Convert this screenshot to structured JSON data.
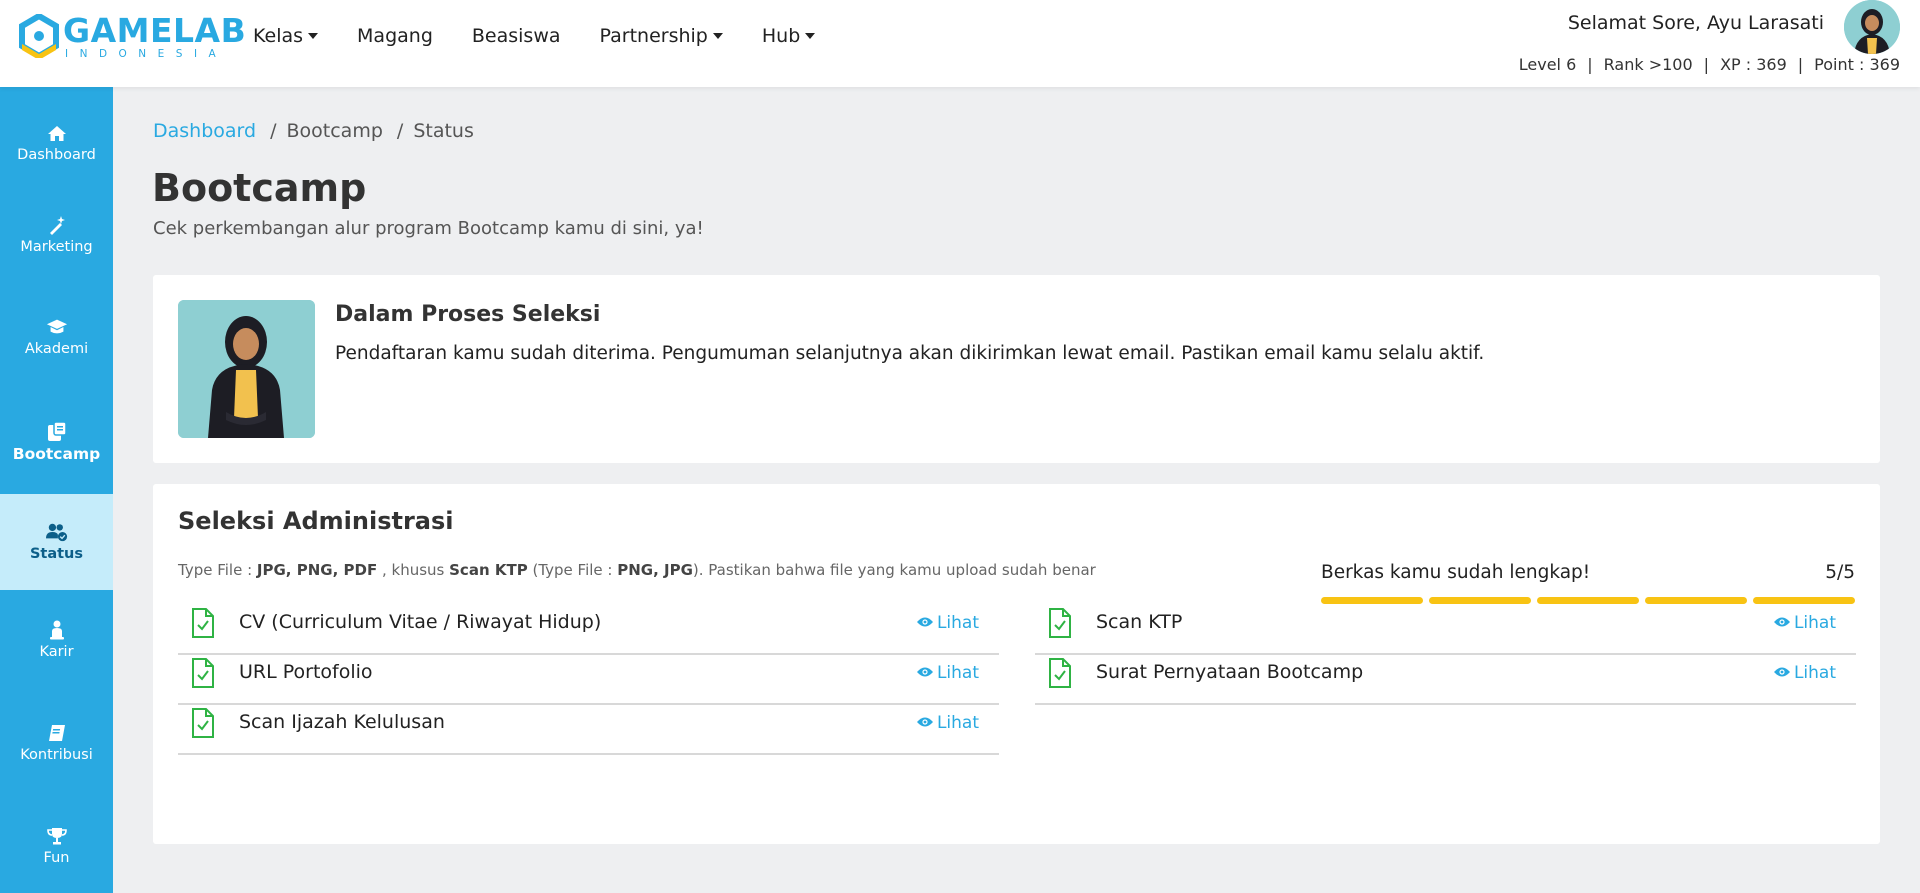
{
  "brand": {
    "name": "GAMELAB",
    "sub": "INDONESIA",
    "color": "#29a9e1"
  },
  "nav": [
    {
      "label": "Kelas",
      "dropdown": true
    },
    {
      "label": "Magang",
      "dropdown": false
    },
    {
      "label": "Beasiswa",
      "dropdown": false
    },
    {
      "label": "Partnership",
      "dropdown": true
    },
    {
      "label": "Hub",
      "dropdown": true
    }
  ],
  "user": {
    "greeting": "Selamat Sore, Ayu Larasati",
    "level": "Level 6",
    "rank": "Rank >100",
    "xp": "XP : 369",
    "point": "Point : 369"
  },
  "sidebar": [
    {
      "label": "Dashboard",
      "icon": "home-icon"
    },
    {
      "label": "Marketing",
      "icon": "magic-wand-icon"
    },
    {
      "label": "Akademi",
      "icon": "graduation-cap-icon"
    },
    {
      "label": "Bootcamp",
      "icon": "briefcase-doc-icon"
    },
    {
      "label": "Status",
      "icon": "users-check-icon",
      "active": true
    },
    {
      "label": "Karir",
      "icon": "person-icon"
    },
    {
      "label": "Kontribusi",
      "icon": "book-icon"
    },
    {
      "label": "Fun",
      "icon": "trophy-icon"
    }
  ],
  "breadcrumb": {
    "home": "Dashboard",
    "mid": "Bootcamp",
    "current": "Status"
  },
  "page": {
    "title": "Bootcamp",
    "subtitle": "Cek perkembangan alur program Bootcamp kamu di sini, ya!"
  },
  "status_card": {
    "title": "Dalam Proses Seleksi",
    "description": "Pendaftaran kamu sudah diterima. Pengumuman selanjutnya akan dikirimkan lewat email. Pastikan email kamu selalu aktif."
  },
  "admin": {
    "title": "Seleksi Administrasi",
    "filetype": {
      "prefix": "Type File : ",
      "types": "JPG, PNG, PDF",
      "mid": " , khusus ",
      "ktp": "Scan KTP",
      "mid2": " (Type File : ",
      "ktp_types": "PNG, JPG",
      "suffix": "). Pastikan bahwa file yang kamu upload sudah benar"
    },
    "progress_label": "Berkas kamu sudah lengkap!",
    "progress_count": "5/5",
    "progress_done": 5,
    "progress_total": 5,
    "progress_color": "#f8c313",
    "link_label": "Lihat",
    "docs_left": [
      "CV (Curriculum Vitae / Riwayat Hidup)",
      "URL Portofolio",
      "Scan Ijazah Kelulusan"
    ],
    "docs_right": [
      "Scan KTP",
      "Surat Pernyataan Bootcamp"
    ],
    "check_color": "#2fb344"
  }
}
